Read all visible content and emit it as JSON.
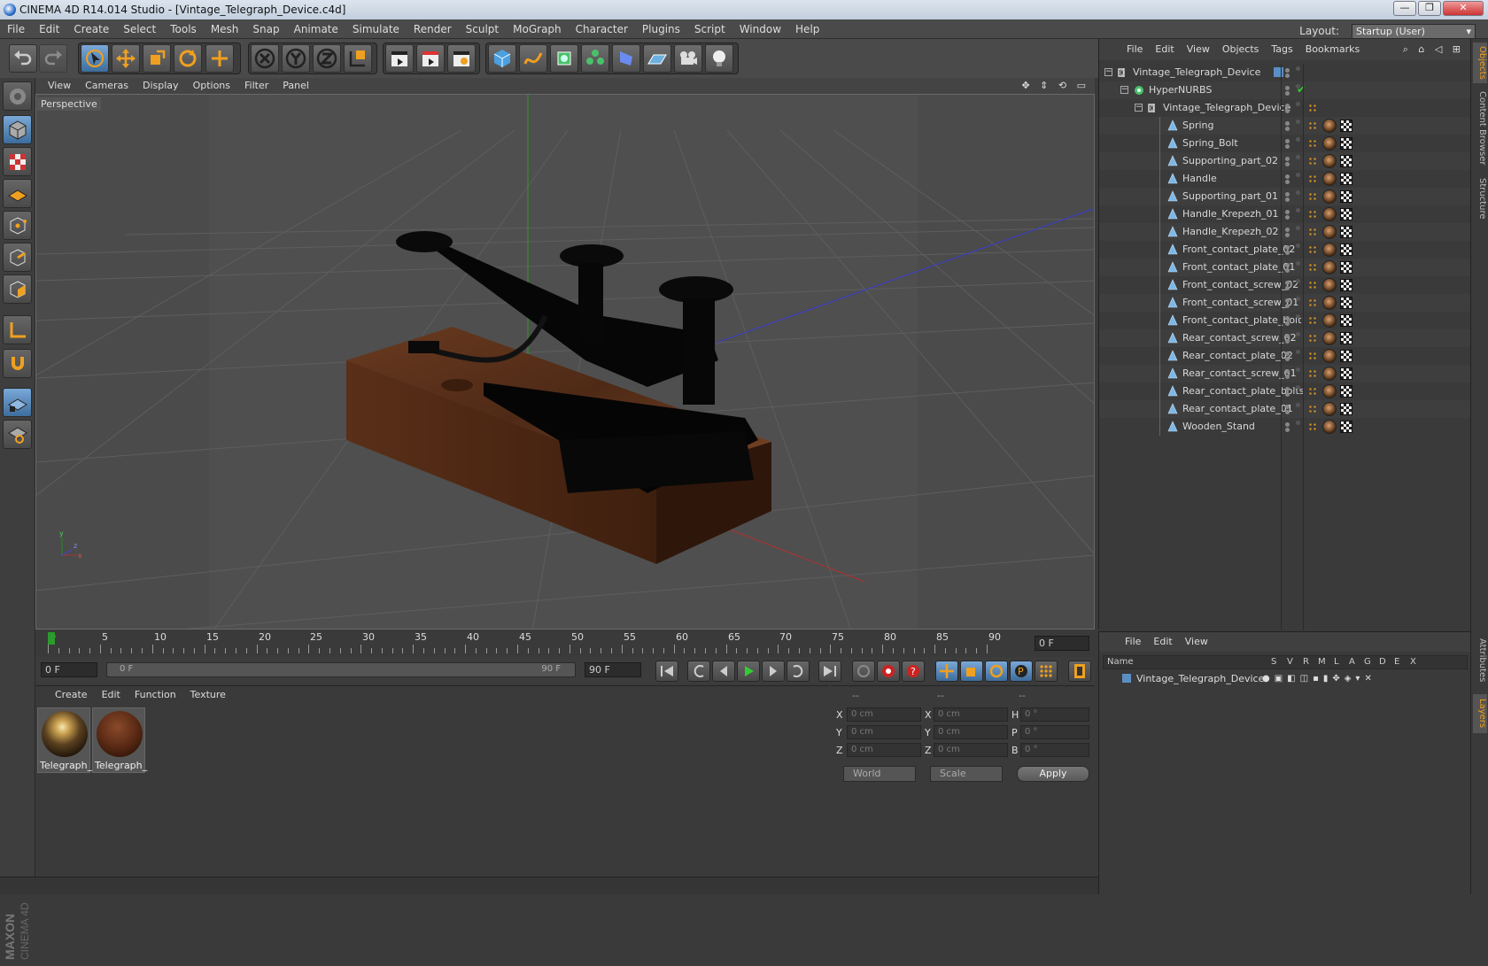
{
  "window": {
    "title": "CINEMA 4D R14.014 Studio - [Vintage_Telegraph_Device.c4d]"
  },
  "menu": [
    "File",
    "Edit",
    "Create",
    "Select",
    "Tools",
    "Mesh",
    "Snap",
    "Animate",
    "Simulate",
    "Render",
    "Sculpt",
    "MoGraph",
    "Character",
    "Plugins",
    "Script",
    "Window",
    "Help"
  ],
  "layout": {
    "label": "Layout:",
    "value": "Startup (User)"
  },
  "viewport": {
    "menu": [
      "View",
      "Cameras",
      "Display",
      "Options",
      "Filter",
      "Panel"
    ],
    "label": "Perspective"
  },
  "timeline": {
    "ticks": [
      "0",
      "5",
      "10",
      "15",
      "20",
      "25",
      "30",
      "35",
      "40",
      "45",
      "50",
      "55",
      "60",
      "65",
      "70",
      "75",
      "80",
      "85",
      "90"
    ],
    "current_frame": "0 F",
    "start_frame": "0 F",
    "range_start": "0 F",
    "range_end": "90 F",
    "end_frame": "90 F"
  },
  "materials": {
    "menu": [
      "Create",
      "Edit",
      "Function",
      "Texture"
    ],
    "items": [
      {
        "name": "Telegraph_"
      },
      {
        "name": "Telegraph_"
      }
    ]
  },
  "coordinates": {
    "header": [
      "--",
      "--",
      "--"
    ],
    "rows": [
      {
        "a": "X",
        "av": "0 cm",
        "b": "X",
        "bv": "0 cm",
        "c": "H",
        "cv": "0 °"
      },
      {
        "a": "Y",
        "av": "0 cm",
        "b": "Y",
        "bv": "0 cm",
        "c": "P",
        "cv": "0 °"
      },
      {
        "a": "Z",
        "av": "0 cm",
        "b": "Z",
        "bv": "0 cm",
        "c": "B",
        "cv": "0 °"
      }
    ],
    "mode": "World",
    "scale": "Scale",
    "apply": "Apply"
  },
  "objects": {
    "menu": [
      "File",
      "Edit",
      "View",
      "Objects",
      "Tags",
      "Bookmarks"
    ],
    "tree": [
      {
        "name": "Vintage_Telegraph_Device",
        "level": 0,
        "type": "null"
      },
      {
        "name": "HyperNURBS",
        "level": 1,
        "type": "nurbs"
      },
      {
        "name": "Vintage_Telegraph_Device",
        "level": 2,
        "type": "null"
      },
      {
        "name": "Spring",
        "level": 3,
        "type": "poly"
      },
      {
        "name": "Spring_Bolt",
        "level": 3,
        "type": "poly"
      },
      {
        "name": "Supporting_part_02",
        "level": 3,
        "type": "poly"
      },
      {
        "name": "Handle",
        "level": 3,
        "type": "poly"
      },
      {
        "name": "Supporting_part_01",
        "level": 3,
        "type": "poly"
      },
      {
        "name": "Handle_Krepezh_01",
        "level": 3,
        "type": "poly"
      },
      {
        "name": "Handle_Krepezh_02",
        "level": 3,
        "type": "poly"
      },
      {
        "name": "Front_contact_plate_02",
        "level": 3,
        "type": "poly"
      },
      {
        "name": "Front_contact_plate_01",
        "level": 3,
        "type": "poly"
      },
      {
        "name": "Front_contact_screw_02",
        "level": 3,
        "type": "poly"
      },
      {
        "name": "Front_contact_screw_01",
        "level": 3,
        "type": "poly"
      },
      {
        "name": "Front_contact_plate_bolt",
        "level": 3,
        "type": "poly"
      },
      {
        "name": "Rear_contact_screw_02",
        "level": 3,
        "type": "poly"
      },
      {
        "name": "Rear_contact_plate_02",
        "level": 3,
        "type": "poly"
      },
      {
        "name": "Rear_contact_screw_01",
        "level": 3,
        "type": "poly"
      },
      {
        "name": "Rear_contact_plate_bolts",
        "level": 3,
        "type": "poly"
      },
      {
        "name": "Rear_contact_plate_01",
        "level": 3,
        "type": "poly"
      },
      {
        "name": "Wooden_Stand",
        "level": 3,
        "type": "poly"
      }
    ]
  },
  "layers": {
    "menu": [
      "File",
      "Edit",
      "View"
    ],
    "columns": [
      "Name",
      "S",
      "V",
      "R",
      "M",
      "L",
      "A",
      "G",
      "D",
      "E",
      "X"
    ],
    "rows": [
      {
        "name": "Vintage_Telegraph_Device"
      }
    ]
  },
  "side_tabs": [
    "Objects",
    "Content Browser",
    "Structure",
    "Attributes",
    "Layers"
  ],
  "brand": {
    "maxon": "MAXON",
    "product": "CINEMA 4D"
  },
  "colors": {
    "accent": "#f0a020",
    "selection": "#5b8fc4",
    "viewport_bg": "#4b4b4b"
  }
}
